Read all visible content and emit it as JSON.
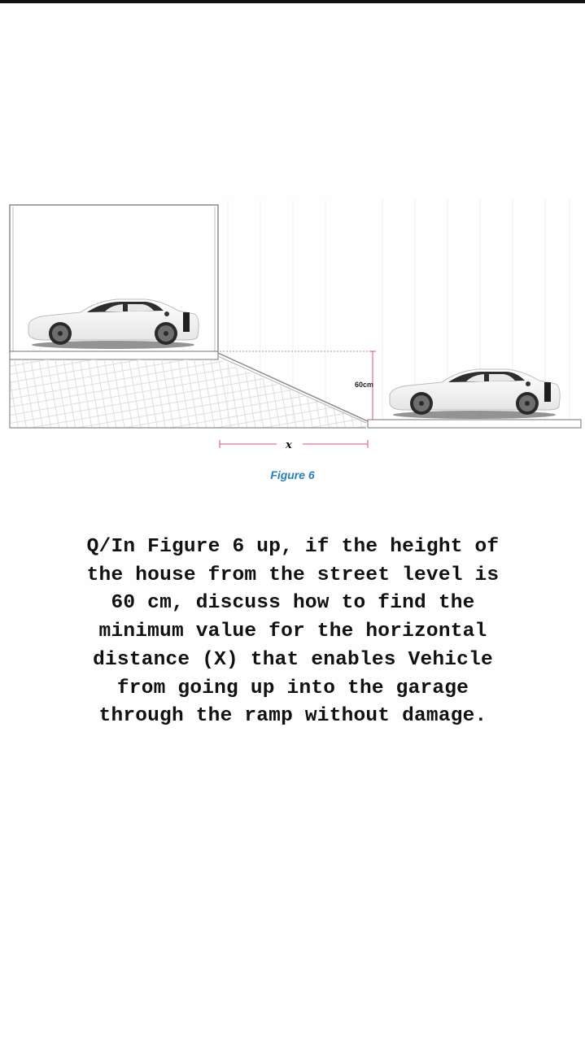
{
  "figure": {
    "caption": "Figure 6",
    "height_label": "60cm",
    "distance_label": "x",
    "elements": [
      "garage",
      "car-in-garage",
      "ramp",
      "street",
      "car-on-street",
      "height-dimension",
      "distance-dimension"
    ],
    "colors": {
      "caption": "#2a7fb8",
      "dimension_line": "#d9536f",
      "outline": "#8a8a8a",
      "car_body": "#f4f4f4"
    }
  },
  "question": {
    "lines": [
      "Q/In Figure 6 up, if the height of",
      "the house from the street level is",
      "60 cm, discuss how to find the",
      "minimum value for the horizontal",
      "distance (X) that enables  Vehicle",
      "from going up into the garage",
      "through the ramp without damage."
    ],
    "text": "Q/In Figure 6 up, if the height of\nthe house from the street level is\n60 cm, discuss how to find the\nminimum value for the horizontal\ndistance (X) that enables  Vehicle\nfrom going up into the garage\nthrough the ramp without damage."
  }
}
